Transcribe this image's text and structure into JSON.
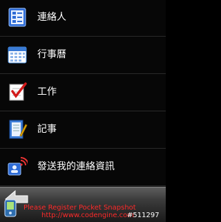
{
  "menu": {
    "items": [
      {
        "label": "連絡人",
        "icon": "contacts-icon"
      },
      {
        "label": "行事曆",
        "icon": "calendar-icon"
      },
      {
        "label": "工作",
        "icon": "tasks-icon"
      },
      {
        "label": "記事",
        "icon": "notes-icon"
      },
      {
        "label": "發送我的連絡資訊",
        "icon": "send-contact-info-icon"
      }
    ]
  },
  "bottom_bar": {
    "back_icon": "back-arrow-icon"
  },
  "watermark": {
    "line1": "Please Register Pocket Snapshot",
    "line2": "http://www.codengine.com",
    "tag": "#511297",
    "icon": "pda-icon"
  },
  "colors": {
    "background": "#070707",
    "text": "#ffffff",
    "watermark_red": "#ff2a2a"
  }
}
